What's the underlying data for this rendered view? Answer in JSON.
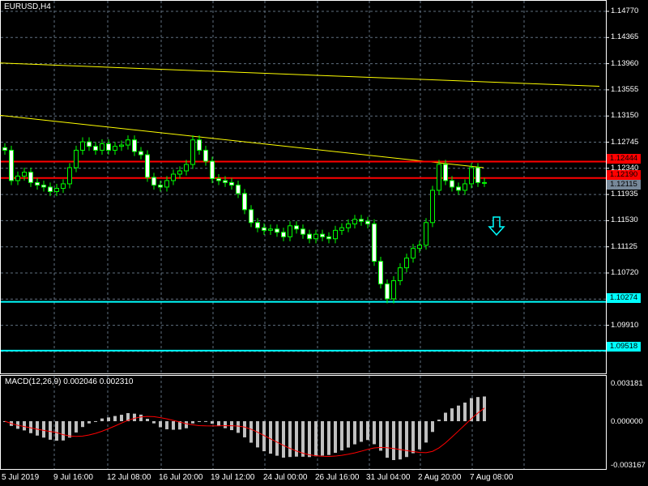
{
  "symbol_title": "EURUSD,H4",
  "macd_title": "MACD(12,26,9) 0.002046 0.002310",
  "price_axis": [
    "1.14770",
    "1.14365",
    "1.13960",
    "1.13555",
    "1.13150",
    "1.12745",
    "1.12340",
    "1.11935",
    "1.11530",
    "1.11125",
    "1.10720",
    "1.09910"
  ],
  "macd_axis": [
    "0.003181",
    "0.000000",
    "-0.003167"
  ],
  "time_axis": [
    "5 Jul 2019",
    "9 Jul 16:00",
    "12 Jul 08:00",
    "16 Jul 20:00",
    "19 Jul 12:00",
    "24 Jul 00:00",
    "26 Jul 16:00",
    "31 Jul 04:00",
    "2 Aug 20:00",
    "7 Aug 08:00"
  ],
  "level_tags": {
    "resistance_1": "1.12444",
    "resistance_2": "1.12190",
    "bid": "1.12115",
    "support_1": "1.10274",
    "support_2": "1.09518"
  },
  "colors": {
    "bull": "#00ff00",
    "bear": "#ffffff",
    "resistance": "#ff0000",
    "support": "#00ffff",
    "trendline": "#ffff00",
    "grid": "#607080",
    "bid_tag": "#778899"
  },
  "chart_data": {
    "type": "candlestick",
    "title": "EURUSD,H4",
    "ylim": [
      1.0925,
      1.149
    ],
    "levels": {
      "resistance": [
        1.12444,
        1.1219
      ],
      "support": [
        1.10274,
        1.09518
      ],
      "bid": 1.12115
    },
    "trendlines": [
      [
        1.1397,
        1.1361
      ],
      [
        1.1316,
        1.1235
      ]
    ],
    "closes": [
      1.1262,
      1.1215,
      1.1222,
      1.1228,
      1.1212,
      1.1208,
      1.1205,
      1.1198,
      1.1203,
      1.121,
      1.1235,
      1.1262,
      1.1275,
      1.1268,
      1.1262,
      1.1272,
      1.1262,
      1.1268,
      1.127,
      1.1278,
      1.126,
      1.1255,
      1.122,
      1.1208,
      1.1205,
      1.1215,
      1.1225,
      1.123,
      1.124,
      1.1278,
      1.1262,
      1.1245,
      1.1218,
      1.1215,
      1.1212,
      1.1208,
      1.1195,
      1.117,
      1.115,
      1.1142,
      1.1138,
      1.114,
      1.1135,
      1.1128,
      1.1145,
      1.114,
      1.1132,
      1.1125,
      1.1132,
      1.1128,
      1.1125,
      1.1138,
      1.1142,
      1.1148,
      1.1155,
      1.1152,
      1.1148,
      1.109,
      1.1055,
      1.1032,
      1.106,
      1.108,
      1.1095,
      1.111,
      1.1115,
      1.115,
      1.12,
      1.124,
      1.1215,
      1.1205,
      1.12,
      1.121,
      1.1235,
      1.1212,
      1.1212
    ],
    "macd_range": [
      -0.003167,
      0.003181
    ]
  }
}
